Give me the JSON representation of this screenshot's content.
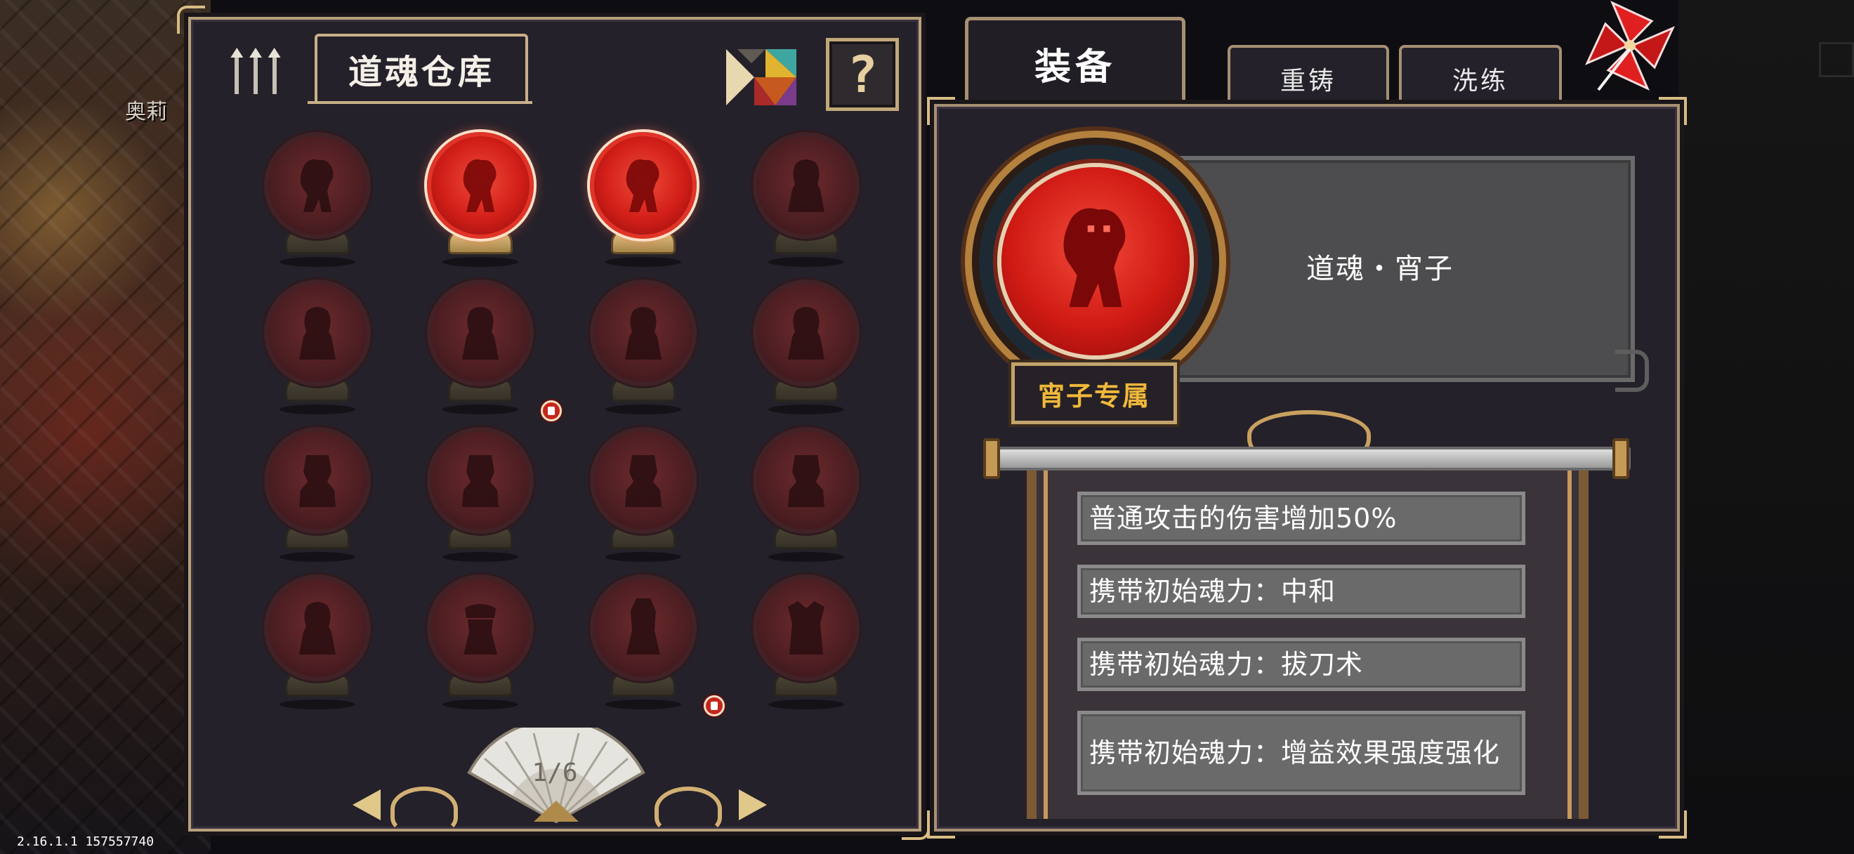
{
  "background": {
    "character_name": "奥莉",
    "top_text_left": "",
    "top_text_right": ""
  },
  "version": "2.16.1.1 157557740",
  "warehouse": {
    "title": "道魂仓库",
    "help_label": "?",
    "page_indicator": "1/6",
    "orbs": [
      {
        "figure": "lion",
        "active": false
      },
      {
        "figure": "lion",
        "active": true
      },
      {
        "figure": "lion",
        "active": true
      },
      {
        "figure": "maiden",
        "active": false
      },
      {
        "figure": "maiden",
        "active": false
      },
      {
        "figure": "maiden",
        "active": false,
        "marker": true
      },
      {
        "figure": "maiden",
        "active": false
      },
      {
        "figure": "maiden",
        "active": false
      },
      {
        "figure": "warrior",
        "active": false
      },
      {
        "figure": "warrior",
        "active": false
      },
      {
        "figure": "warrior",
        "active": false
      },
      {
        "figure": "warrior",
        "active": false
      },
      {
        "figure": "maiden",
        "active": false
      },
      {
        "figure": "bandana",
        "active": false
      },
      {
        "figure": "knight",
        "active": false,
        "marker": true
      },
      {
        "figure": "beast",
        "active": false
      }
    ]
  },
  "tabs": {
    "equip": "装备",
    "recast": "重铸",
    "refine": "洗练"
  },
  "equipped": {
    "name": "道魂・宵子",
    "exclusive_badge": "宵子专属",
    "effects": [
      "普通攻击的伤害增加50%",
      "携带初始魂力：中和",
      "携带初始魂力：拔刀术",
      "携带初始魂力：增益效果强度强化"
    ]
  },
  "colors": {
    "accent_gold": "#c8b088",
    "orb_active_red": "#d11e18",
    "badge_text": "#f0b83a"
  }
}
